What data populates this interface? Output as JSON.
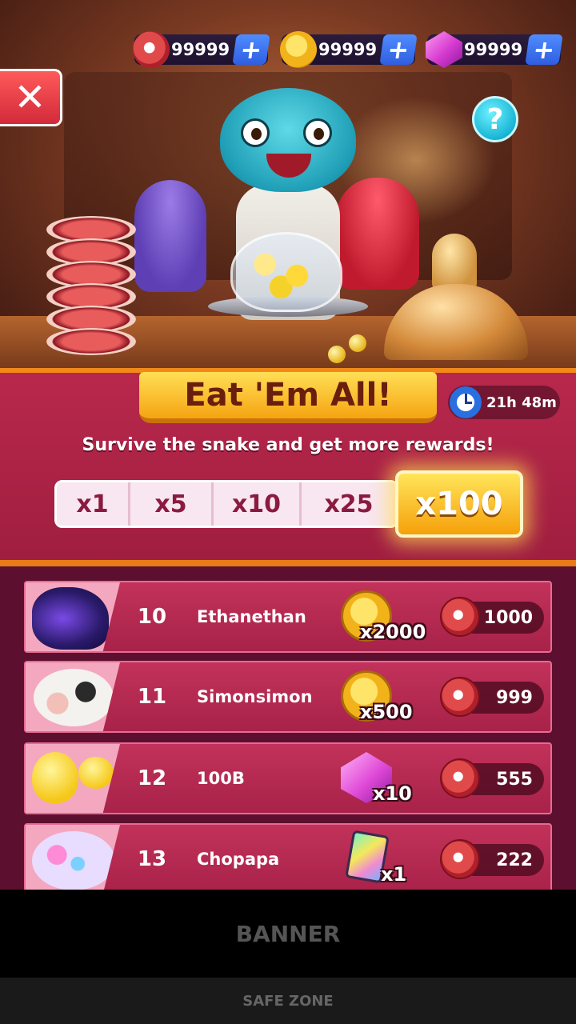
{
  "resources": {
    "meat": {
      "value": "99999",
      "icon": "meat-icon"
    },
    "coins": {
      "value": "99999",
      "icon": "coin-icon"
    },
    "gems": {
      "value": "99999",
      "icon": "gem-icon"
    },
    "plus_label": "+"
  },
  "buttons": {
    "close_label": "✕",
    "help_label": "?"
  },
  "event": {
    "title": "Eat 'Em All!",
    "timer": "21h 48m",
    "subtitle": "Survive the snake and get more rewards!",
    "multipliers": [
      "x1",
      "x5",
      "x10",
      "x25"
    ],
    "active_multiplier": "x100"
  },
  "leaderboard": [
    {
      "rank": "10",
      "name": "Ethanethan",
      "avatar": "dragon-avatar",
      "reward_icon": "coin-icon",
      "reward_qty": "x2000",
      "score": "1000"
    },
    {
      "rank": "11",
      "name": "Simonsimon",
      "avatar": "cow-avatar",
      "reward_icon": "coin-icon",
      "reward_qty": "x500",
      "score": "999"
    },
    {
      "rank": "12",
      "name": "100B",
      "avatar": "duck-avatar",
      "reward_icon": "gem-icon",
      "reward_qty": "x10",
      "score": "555"
    },
    {
      "rank": "13",
      "name": "Chopapa",
      "avatar": "unicorn-avatar",
      "reward_icon": "card-icon",
      "reward_qty": "x1",
      "score": "222"
    }
  ],
  "bottom": {
    "banner": "BANNER",
    "safe_zone": "SAFE ZONE"
  },
  "colors": {
    "accent_orange": "#f28a1a",
    "panel_red": "#b8284c",
    "title_gold": "#ffdf55",
    "plus_blue": "#4f8cff"
  }
}
